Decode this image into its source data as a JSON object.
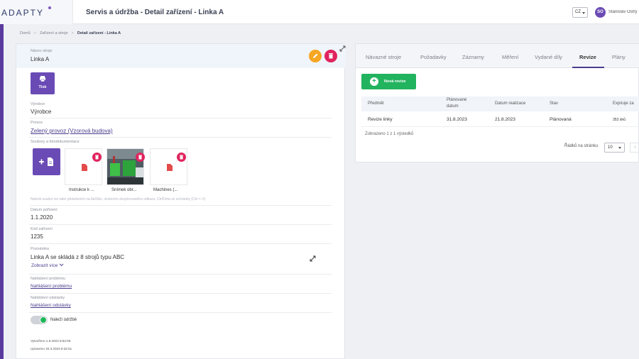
{
  "app": {
    "logo_text": "ADAPTY",
    "page_title": "Servis a údržba - Detail zařízení - Linka A"
  },
  "header": {
    "language": "CZ",
    "user_initials": "SO",
    "user_name": "Stanislav Ostrý"
  },
  "breadcrumb": [
    "Domů",
    "Zařízení a stroje",
    "Detail zařízení - Linka A"
  ],
  "device": {
    "name_label": "Název stroje",
    "name_value": "Linka A",
    "print_label": "Tisk",
    "manufacturer_label": "Výrobce",
    "manufacturer_value": "Výrobce",
    "operation_label": "Provoz",
    "operation_value": "Zelený provoz (Vzorová budova)",
    "files_label": "Soubory a fotodokumentace",
    "files": [
      {
        "name": "Instrukce k ...",
        "icon": "pdf-icon"
      },
      {
        "name": "Snímek obr...",
        "icon": "image-thumbnail"
      },
      {
        "name": "Machines (...",
        "icon": "pdf-icon"
      }
    ],
    "files_hint": "Nahrát soubor lze také přetažením na tlačítko, vložením zkopírovaného odkazu, CtrlOma ze schránky (Ctrl + V)",
    "purchase_date_label": "Datum pořízení",
    "purchase_date_value": "1.1.2020",
    "code_label": "Kód zařízení",
    "code_value": "1235",
    "note_label": "Poznámka",
    "note_value": "Linka A se skládá z 8 strojů typu ABC",
    "show_more": "Zobrazit více",
    "report_problem_label": "Nahlášení problému",
    "report_problem_link": "Nahlášení problému",
    "report_stop_label": "Nahlášení odstávky",
    "report_stop_link": "Nahlášení odstávky",
    "toggle_label": "Náleží údržbě",
    "toggle_on": true,
    "created": "Vytvořeno 1.8.2023 8:52:06",
    "updated": "Upraveno 20.3.2023 9:32:51"
  },
  "tabs": [
    {
      "label": "Návazné stroje",
      "active": false
    },
    {
      "label": "Požadavky",
      "active": false
    },
    {
      "label": "Záznamy",
      "active": false
    },
    {
      "label": "Měření",
      "active": false
    },
    {
      "label": "Vydané díly",
      "active": false
    },
    {
      "label": "Revize",
      "active": true
    },
    {
      "label": "Plány",
      "active": false
    }
  ],
  "revisions": {
    "new_button": "Nová revize",
    "columns": [
      "Předmět",
      "Plánované datum",
      "Datum realizace",
      "Stav",
      "Expiruje za"
    ],
    "rows": [
      {
        "subject": "Revize linky",
        "planned": "31.8.2023",
        "realized": "21.8.2023",
        "state": "Plánovaná",
        "expires": "353 dnů"
      }
    ],
    "shown_text": "Zobrazeno 1 z 1 výsledků",
    "rows_per_page_label": "Řádků na stránku",
    "rows_per_page_value": "10"
  },
  "colors": {
    "brand_purple": "#6a4bb6",
    "accent_green": "#22b35e",
    "delete_red": "#e0245e",
    "edit_orange": "#f5a623"
  }
}
